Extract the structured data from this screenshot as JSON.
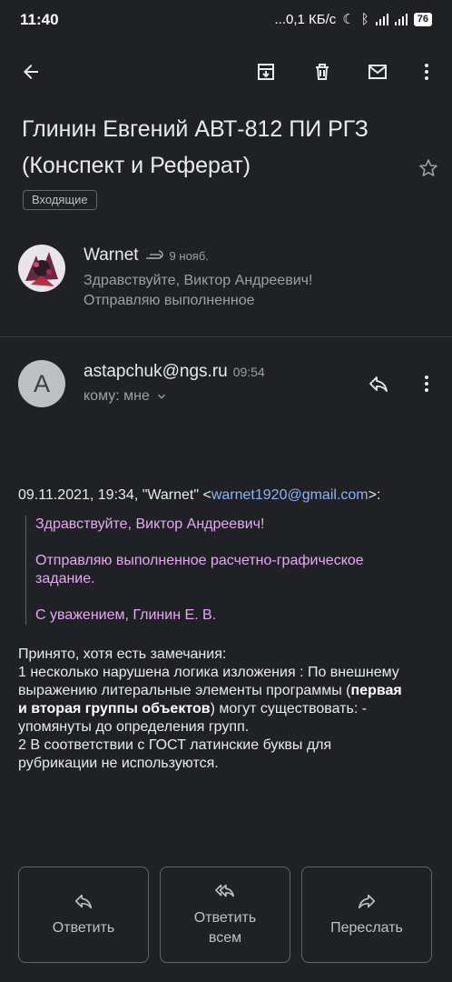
{
  "status_bar": {
    "time": "11:40",
    "net_speed": "...0,1 КБ/с",
    "battery": "76"
  },
  "toolbar": {
    "back_icon": "arrow-left-icon",
    "archive_icon": "archive-icon",
    "delete_icon": "trash-icon",
    "mark_unread_icon": "mail-icon",
    "more_icon": "more-vert-icon"
  },
  "thread": {
    "subject": "Глинин Евгений АВТ-812 ПИ РГЗ (Конспект и Реферат)",
    "label": "Входящие"
  },
  "message1": {
    "sender": "Warnet",
    "date": "9 нояб.",
    "snippet": "Здравствуйте, Виктор Андреевич! Отправляю выполненное"
  },
  "message2": {
    "avatar_letter": "A",
    "sender": "astapchuk@ngs.ru",
    "time": "09:54",
    "to": "кому: мне",
    "header_prefix": "09.11.2021, 19:34, \"Warnet\" <",
    "header_email": "warnet1920@gmail.com",
    "header_suffix": ">:",
    "quote": [
      "Здравствуйте, Виктор Андреевич!",
      "Отправляю выполненное расчетно-графическое задание.",
      "С уважением, Глинин Е. В."
    ],
    "reply": {
      "line1": "Принято, хотя есть замечания:",
      "line2_a": "1 несколько нарушена логика изложения : По внешнему выражению литеральные элементы программы (",
      "line2_bold": "первая и вторая группы объектов",
      "line2_b": ") могут существовать: - упомянуты до определения групп.",
      "line3": "2 В соответствии с ГОСТ латинские буквы для рубрикации не используются."
    }
  },
  "actions": {
    "reply": "Ответить",
    "reply_all": "Ответить всем",
    "forward": "Переслать"
  }
}
